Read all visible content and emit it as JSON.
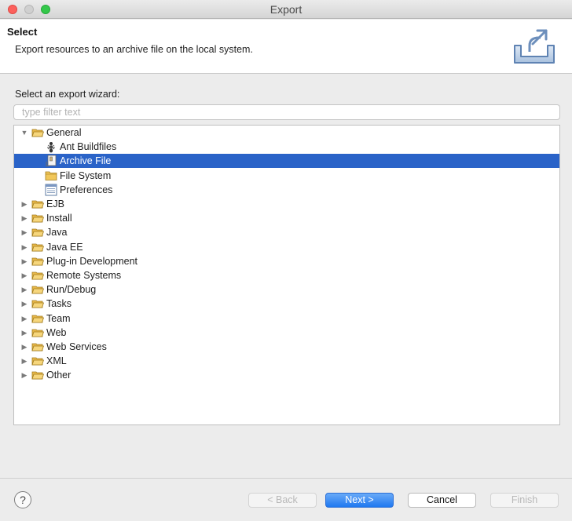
{
  "window": {
    "title": "Export"
  },
  "header": {
    "title": "Select",
    "description": "Export resources to an archive file on the local system.",
    "icon": "export-archive-icon"
  },
  "wizard": {
    "label": "Select an export wizard:",
    "filter_placeholder": "type filter text"
  },
  "tree": {
    "items": [
      {
        "label": "General",
        "level": 0,
        "expanded": true,
        "icon": "folder-open-icon"
      },
      {
        "label": "Ant Buildfiles",
        "level": 1,
        "icon": "ant-icon"
      },
      {
        "label": "Archive File",
        "level": 1,
        "icon": "archive-file-icon",
        "selected": true
      },
      {
        "label": "File System",
        "level": 1,
        "icon": "folder-icon"
      },
      {
        "label": "Preferences",
        "level": 1,
        "icon": "preferences-icon"
      },
      {
        "label": "EJB",
        "level": 0,
        "expanded": false,
        "icon": "folder-open-icon"
      },
      {
        "label": "Install",
        "level": 0,
        "expanded": false,
        "icon": "folder-open-icon"
      },
      {
        "label": "Java",
        "level": 0,
        "expanded": false,
        "icon": "folder-open-icon"
      },
      {
        "label": "Java EE",
        "level": 0,
        "expanded": false,
        "icon": "folder-open-icon"
      },
      {
        "label": "Plug-in Development",
        "level": 0,
        "expanded": false,
        "icon": "folder-open-icon"
      },
      {
        "label": "Remote Systems",
        "level": 0,
        "expanded": false,
        "icon": "folder-open-icon"
      },
      {
        "label": "Run/Debug",
        "level": 0,
        "expanded": false,
        "icon": "folder-open-icon"
      },
      {
        "label": "Tasks",
        "level": 0,
        "expanded": false,
        "icon": "folder-open-icon"
      },
      {
        "label": "Team",
        "level": 0,
        "expanded": false,
        "icon": "folder-open-icon"
      },
      {
        "label": "Web",
        "level": 0,
        "expanded": false,
        "icon": "folder-open-icon"
      },
      {
        "label": "Web Services",
        "level": 0,
        "expanded": false,
        "icon": "folder-open-icon"
      },
      {
        "label": "XML",
        "level": 0,
        "expanded": false,
        "icon": "folder-open-icon"
      },
      {
        "label": "Other",
        "level": 0,
        "expanded": false,
        "icon": "folder-open-icon"
      }
    ]
  },
  "buttons": {
    "help": "?",
    "back": "< Back",
    "next": "Next >",
    "cancel": "Cancel",
    "finish": "Finish"
  },
  "colors": {
    "selection": "#2a63c8",
    "default_button": "#1f78f0",
    "folder": "#e9b949"
  }
}
